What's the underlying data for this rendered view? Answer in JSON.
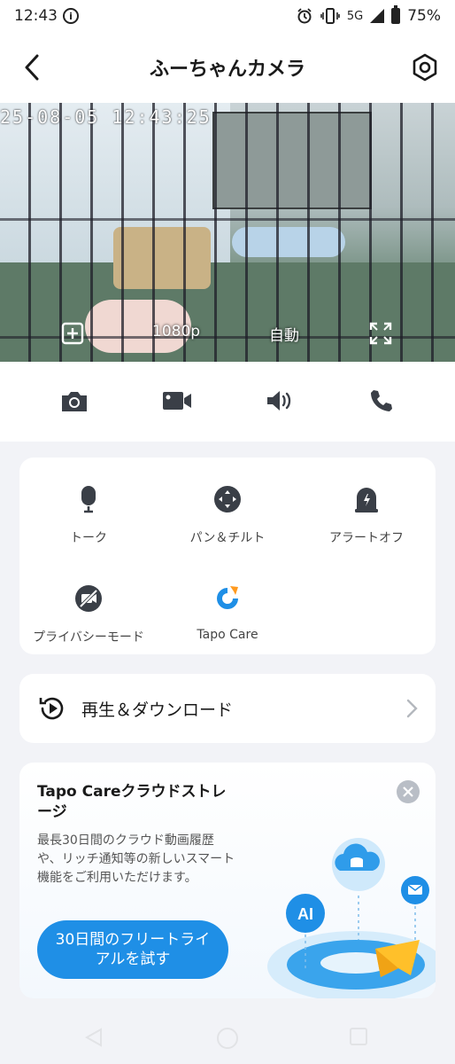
{
  "status_bar": {
    "time": "12:43",
    "network": "5G",
    "battery": "75%",
    "icons": [
      "info-icon",
      "alarm-icon",
      "vibrate-icon",
      "signal-icon",
      "battery-icon"
    ]
  },
  "header": {
    "title": "ふーちゃんカメラ",
    "back_icon": "chevron-left-icon",
    "settings_icon": "hexagon-settings-icon"
  },
  "feed": {
    "timestamp": "25-08-05 12:43:25",
    "controls": {
      "multiview_icon": "multiview-icon",
      "resolution": "1080p",
      "mode": "自動",
      "fullscreen_icon": "fullscreen-icon"
    }
  },
  "action_bar": [
    "camera-icon",
    "video-icon",
    "speaker-icon",
    "phone-icon"
  ],
  "features": [
    {
      "label": "トーク",
      "icon": "microphone-icon"
    },
    {
      "label": "パン＆チルト",
      "icon": "pan-tilt-icon"
    },
    {
      "label": "アラートオフ",
      "icon": "alert-icon"
    },
    {
      "label": "プライバシーモード",
      "icon": "privacy-icon"
    },
    {
      "label": "Tapo Care",
      "icon": "tapo-care-icon"
    }
  ],
  "playback": {
    "label": "再生＆ダウンロード",
    "icon": "playback-icon"
  },
  "promo": {
    "title": "Tapo Careクラウドストレージ",
    "description": "最長30日間のクラウド動画履歴や、リッチ通知等の新しいスマート機能をご利用いただけます。",
    "cta": "30日間のフリートライアルを試す",
    "illustration_text": "AI"
  },
  "colors": {
    "accent": "#1f8fe6",
    "tapo_orange": "#ff9a1f",
    "background": "#f2f3f7"
  }
}
